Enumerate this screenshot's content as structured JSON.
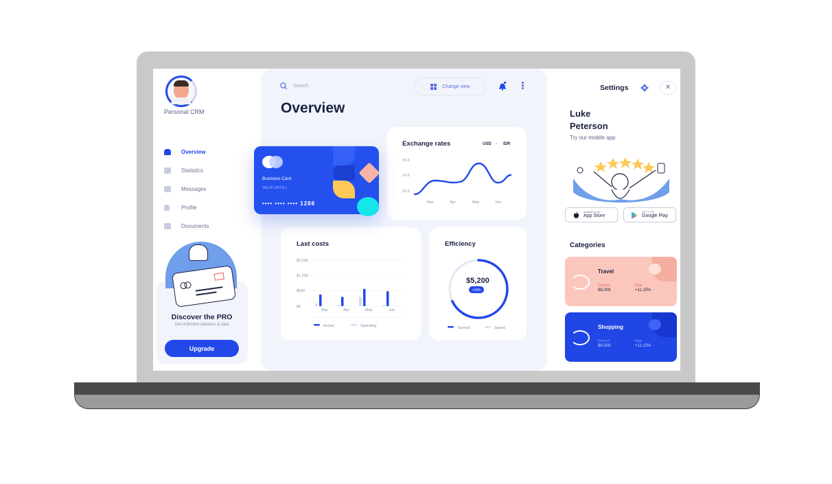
{
  "sidebar": {
    "brand": "Personal CRM",
    "items": [
      {
        "label": "Overview",
        "icon": "home-icon",
        "active": true
      },
      {
        "label": "Statistics",
        "icon": "chart-icon"
      },
      {
        "label": "Messages",
        "icon": "mail-icon"
      },
      {
        "label": "Profile",
        "icon": "user-icon"
      },
      {
        "label": "Documents",
        "icon": "document-icon"
      }
    ],
    "promo": {
      "title": "Discover the PRO",
      "subtitle": "Get unlimited statistics & data",
      "button": "Upgrade"
    }
  },
  "header": {
    "search_placeholder": "Search",
    "change_view": "Change view",
    "title": "Overview"
  },
  "business_card": {
    "label": "Business Card",
    "valid": "VALID UNTILL",
    "number": "•••• •••• •••• 1288"
  },
  "exchange": {
    "title": "Exchange rates",
    "from": "USD",
    "to": "IDR",
    "chart_data": {
      "type": "line",
      "x": [
        "Mar",
        "Apr",
        "May",
        "Jun"
      ],
      "y_ticks": [
        "15.6",
        "14.5",
        "10.2"
      ],
      "ylim": [
        10.2,
        15.6
      ]
    }
  },
  "last_costs": {
    "title": "Last costs",
    "chart_data": {
      "type": "bar",
      "categories": [
        "Mar",
        "Apr",
        "May",
        "Jun"
      ],
      "y_ticks": [
        "$2,000",
        "$1,000",
        "$500",
        "$0"
      ],
      "series": [
        {
          "name": "Arrival",
          "values": [
            0.78,
            0.62,
            1.15,
            0.99
          ]
        },
        {
          "name": "Spending",
          "values": [
            0.18,
            0.08,
            0.62,
            0.08
          ]
        }
      ],
      "colors": {
        "Arrival": "#2348e8",
        "Spending": "#d6dbea"
      }
    }
  },
  "efficiency": {
    "title": "Efficiency",
    "value": "$5,200",
    "badge": "+10%",
    "legend": [
      "Earned",
      "Spend"
    ],
    "progress": 0.68
  },
  "right": {
    "settings": "Settings",
    "user_first": "Luke",
    "user_last": "Peterson",
    "try_app": "Try our mobile app",
    "app_store": {
      "pre": "Available on the",
      "name": "App Store"
    },
    "google_play": {
      "pre": "GET IT ON",
      "name": "Google Play"
    },
    "categories_title": "Categories",
    "categories": [
      {
        "name": "Travel",
        "deposit_label": "Deposit",
        "deposit": "$8,009",
        "rate_label": "Rate",
        "rate": "+11.15%"
      },
      {
        "name": "Shopping",
        "deposit_label": "Deposit",
        "deposit": "$8,009",
        "rate_label": "Rate",
        "rate": "+11.15%"
      }
    ]
  },
  "colors": {
    "accent": "#2348e8",
    "travel_bg": "#fbc7bc",
    "shopping_bg": "#2146e6",
    "cyan": "#15e6ec",
    "yellow": "#ffc857"
  }
}
